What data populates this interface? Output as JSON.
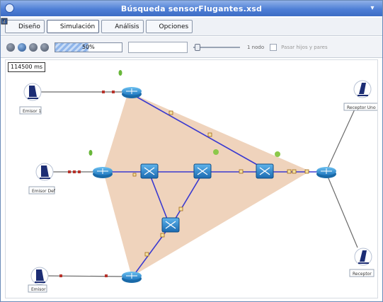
{
  "window": {
    "title": "Búsqueda sensorFlugantes.xsd"
  },
  "tabs": [
    {
      "label": "Diseño",
      "icon": "design-icon"
    },
    {
      "label": "Simulación",
      "icon": "simulation-icon",
      "active": true
    },
    {
      "label": "Análisis",
      "icon": "analysis-icon"
    },
    {
      "label": "Opciones",
      "icon": "options-icon"
    }
  ],
  "simulation": {
    "progress_fraction": 0.5,
    "progress_label": "50%",
    "speed_label": "1 nodo",
    "checkbox_label": "Pasar hijos y pares"
  },
  "canvas": {
    "time_label": "114500 ms"
  },
  "nodes": [
    {
      "id": "emisor1",
      "label": "Emisor 1",
      "kind": "computer"
    },
    {
      "id": "emisor-def",
      "label": "Emisor Def",
      "kind": "computer"
    },
    {
      "id": "emisor",
      "label": "Emisor",
      "kind": "computer"
    },
    {
      "id": "receptor-uno",
      "label": "Receptor Uno",
      "kind": "computer"
    },
    {
      "id": "receptor",
      "label": "Receptor",
      "kind": "computer"
    }
  ],
  "colors": {
    "titlebar": "#4f7fd6",
    "link_active": "#3a3ad0",
    "link_plain": "#555555",
    "packet": "#d99a3a",
    "area": "#e9c4a6",
    "router": "#2d8fd4"
  }
}
